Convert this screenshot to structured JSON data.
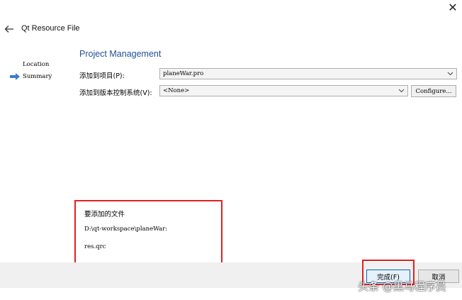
{
  "window": {
    "title": "Qt Resource File",
    "close_glyph": "✕"
  },
  "steps": [
    {
      "label": "Location"
    },
    {
      "label": "Summary"
    }
  ],
  "page": {
    "section_title": "Project Management",
    "project_label": "添加到项目(P):",
    "project_value": "planeWar.pro",
    "vcs_label": "添加到版本控制系统(V):",
    "vcs_value": "<None>",
    "configure_label": "Configure..."
  },
  "files": {
    "heading": "要添加的文件",
    "path": "D:\\qt-workspace\\planeWar:",
    "file": "res.qrc"
  },
  "buttons": {
    "finish": "完成(F)",
    "cancel": "取消"
  },
  "watermark": "头条 @黑马程序员",
  "colors": {
    "highlight_border": "#e02020",
    "section_title": "#1f4f9a",
    "step_arrow": "#3a7bd5",
    "footer_bg": "#f0f0f0"
  }
}
